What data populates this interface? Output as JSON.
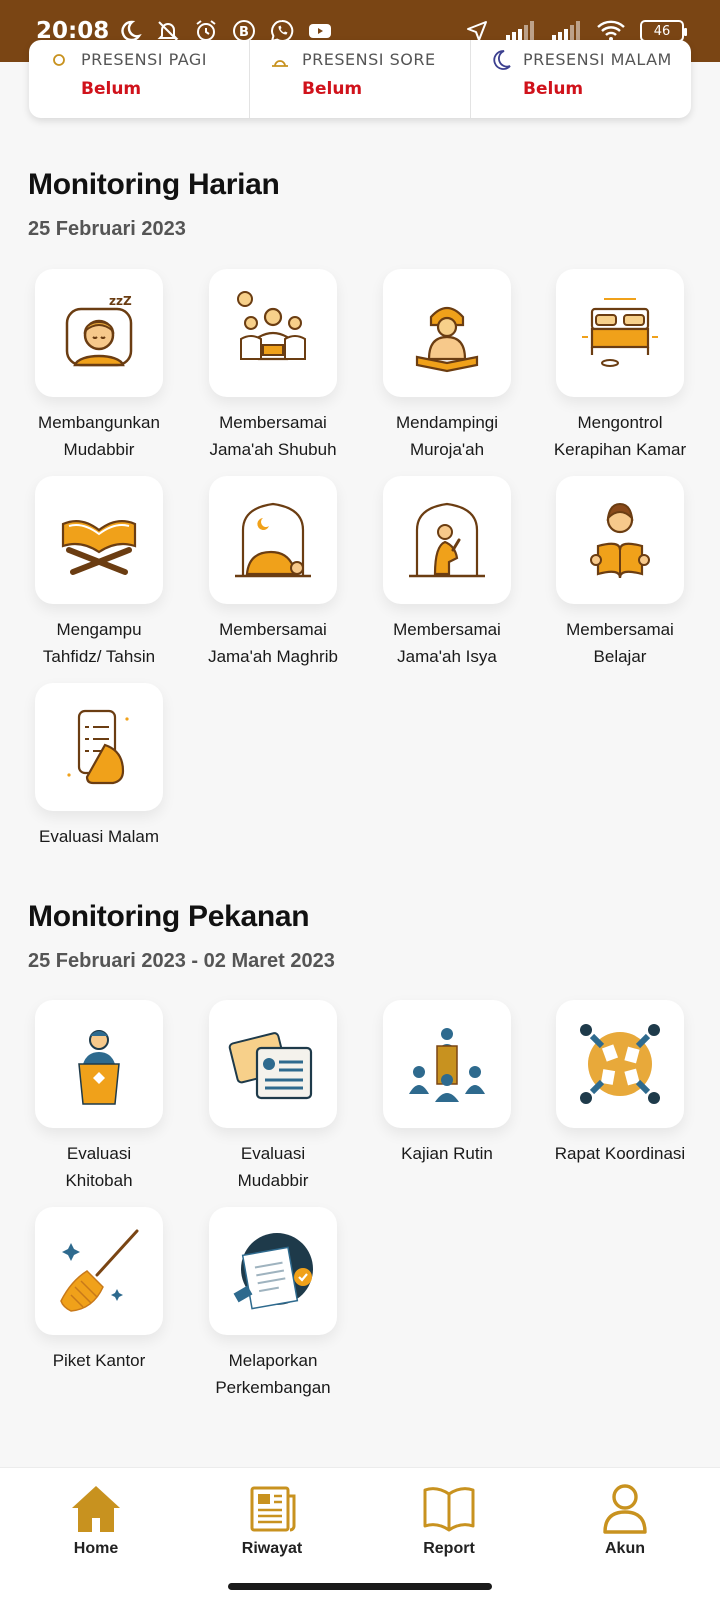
{
  "status_bar": {
    "time": "20:08",
    "battery": "46",
    "left_icons": [
      "moon-icon",
      "muted-bell-icon",
      "alarm-icon",
      "b-badge-icon",
      "whatsapp-icon",
      "youtube-icon"
    ],
    "right_icons": [
      "location-arrow-icon",
      "signal-icon",
      "signal-icon",
      "wifi-icon",
      "battery-icon"
    ]
  },
  "presensi": [
    {
      "label": "PRESENSI PAGI",
      "status": "Belum",
      "icon": "sun-icon"
    },
    {
      "label": "PRESENSI SORE",
      "status": "Belum",
      "icon": "sunset-icon"
    },
    {
      "label": "PRESENSI MALAM",
      "status": "Belum",
      "icon": "moon-icon"
    }
  ],
  "harian": {
    "title": "Monitoring Harian",
    "date": "25 Februari 2023",
    "items": [
      {
        "label": "Membangunkan\nMudabbir",
        "icon": "sleeping-boy-icon"
      },
      {
        "label": "Membersamai\nJama'ah Shubuh",
        "icon": "congregation-icon"
      },
      {
        "label": "Mendampingi\nMuroja'ah",
        "icon": "reading-quran-icon"
      },
      {
        "label": "Mengontrol\nKerapihan Kamar",
        "icon": "bed-icon"
      },
      {
        "label": "Mengampu\nTahfidz/ Tahsin",
        "icon": "open-quran-icon"
      },
      {
        "label": "Membersamai\nJama'ah Maghrib",
        "icon": "prostrating-icon"
      },
      {
        "label": "Membersamai\nJama'ah Isya",
        "icon": "praying-icon"
      },
      {
        "label": "Membersamai\nBelajar",
        "icon": "studying-icon"
      },
      {
        "label": "Evaluasi Malam",
        "icon": "phone-checklist-icon"
      }
    ]
  },
  "pekanan": {
    "title": "Monitoring Pekanan",
    "date": "25 Februari 2023 - 02 Maret 2023",
    "items": [
      {
        "label": "Evaluasi\nKhitobah",
        "icon": "podium-speaker-icon"
      },
      {
        "label": "Evaluasi\nMudabbir",
        "icon": "id-card-icon"
      },
      {
        "label": "Kajian Rutin",
        "icon": "lecture-icon"
      },
      {
        "label": "Rapat Koordinasi",
        "icon": "meeting-table-icon"
      },
      {
        "label": "Piket Kantor",
        "icon": "broom-icon"
      },
      {
        "label": "Melaporkan\nPerkembangan",
        "icon": "report-document-icon"
      }
    ]
  },
  "bottom_nav": [
    {
      "label": "Home",
      "icon": "home-icon"
    },
    {
      "label": "Riwayat",
      "icon": "newspaper-icon"
    },
    {
      "label": "Report",
      "icon": "book-icon"
    },
    {
      "label": "Akun",
      "icon": "user-icon"
    }
  ],
  "colors": {
    "status_bar": "#7a4514",
    "accent_gold": "#c8921f",
    "status_red": "#d0121b",
    "background": "#f7f7f7"
  }
}
